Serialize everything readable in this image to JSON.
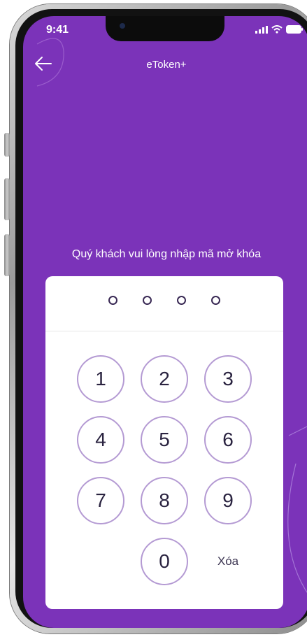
{
  "status_bar": {
    "time": "9:41"
  },
  "header": {
    "title": "eToken+"
  },
  "prompt": "Quý khách vui lòng nhập mã mở khóa",
  "keypad": {
    "keys": [
      "1",
      "2",
      "3",
      "4",
      "5",
      "6",
      "7",
      "8",
      "9",
      "0"
    ],
    "delete_label": "Xóa"
  },
  "colors": {
    "background": "#7b33b9",
    "key_border": "#b49ad3",
    "card": "#ffffff"
  },
  "icons": {
    "back": "arrow-left-icon",
    "signal": "signal-icon",
    "wifi": "wifi-icon",
    "battery": "battery-icon"
  }
}
